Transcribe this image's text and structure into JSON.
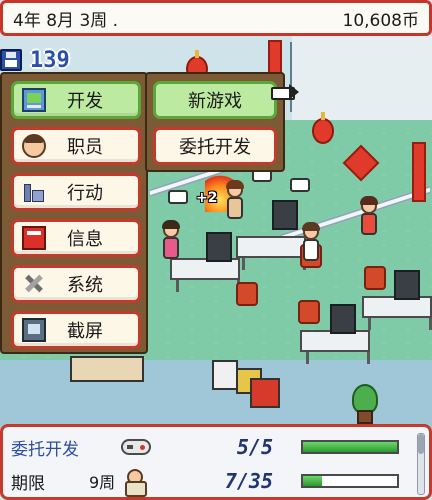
{
  "status_bar": {
    "date": "4年 8月 3周 .",
    "funds": "10,608币"
  },
  "save_counter": {
    "icon": "floppy-disk-icon",
    "value": "139"
  },
  "main_menu": {
    "items": [
      {
        "label": "开发",
        "icon": "develop-icon",
        "active": true
      },
      {
        "label": "职员",
        "icon": "staff-icon",
        "active": false
      },
      {
        "label": "行动",
        "icon": "action-icon",
        "active": false
      },
      {
        "label": "信息",
        "icon": "info-icon",
        "active": false
      },
      {
        "label": "系统",
        "icon": "tools-icon",
        "active": false
      },
      {
        "label": "截屏",
        "icon": "screenshot-icon",
        "active": false
      }
    ]
  },
  "sub_menu": {
    "items": [
      {
        "label": "新游戏",
        "active": true
      },
      {
        "label": "委托开发",
        "active": false
      }
    ]
  },
  "scene": {
    "plus_popup": "+2"
  },
  "project_panel": {
    "row1": {
      "label": "委托开发",
      "icon": "gamepad-icon",
      "value": "5/5",
      "progress": 1.0
    },
    "row2": {
      "label": "期限",
      "weeks": "9周",
      "icon": "staff-walking-icon",
      "value": "7/35",
      "progress": 0.2
    }
  },
  "colors": {
    "accent_red": "#c43a2b",
    "active_green": "#bdeaa1",
    "panel_brown": "#7b5a35",
    "value_blue": "#1e3576"
  }
}
